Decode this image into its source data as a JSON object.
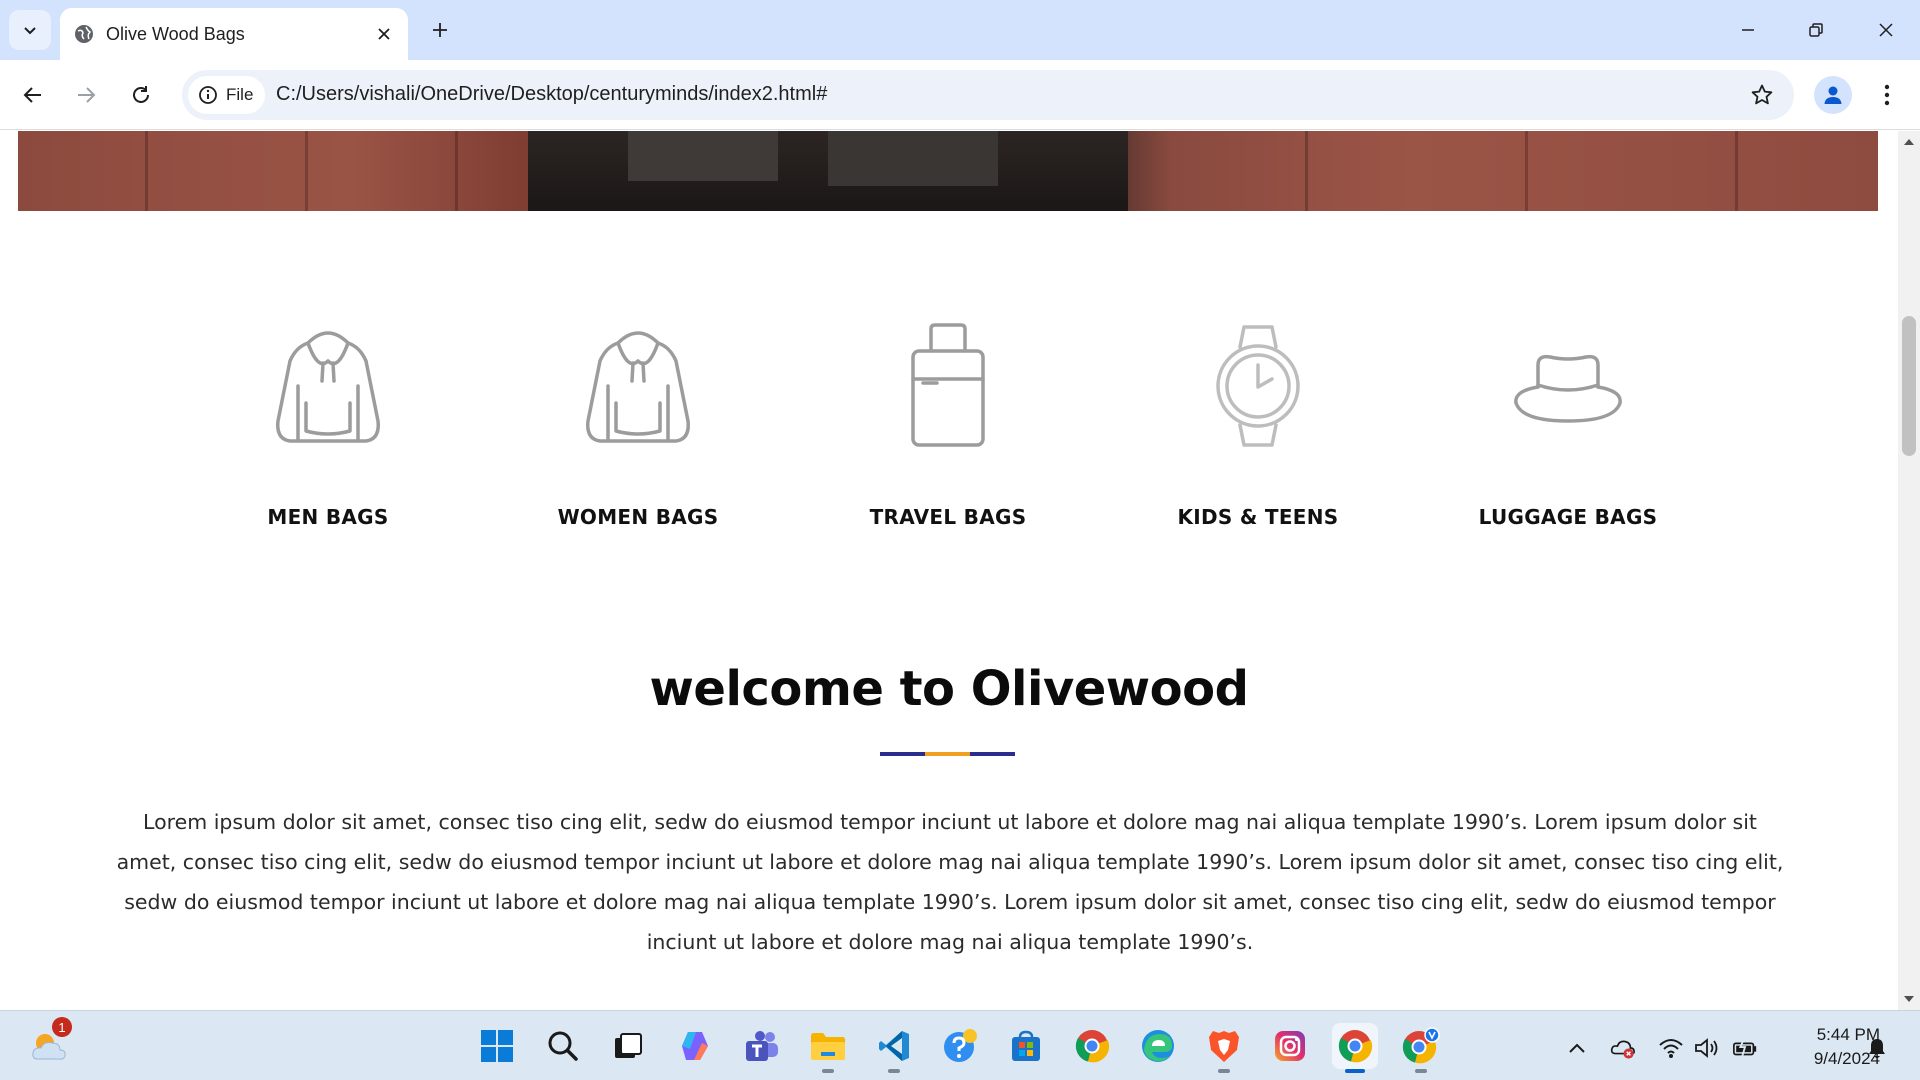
{
  "browser": {
    "tab_title": "Olive Wood Bags",
    "site_chip_label": "File",
    "url": "C:/Users/vishali/OneDrive/Desktop/centuryminds/index2.html#"
  },
  "page": {
    "categories": [
      {
        "label": "MEN BAGS",
        "icon": "hoodie-icon"
      },
      {
        "label": "WOMEN BAGS",
        "icon": "hoodie-icon"
      },
      {
        "label": "TRAVEL BAGS",
        "icon": "suitcase-icon"
      },
      {
        "label": "KIDS & TEENS",
        "icon": "watch-icon"
      },
      {
        "label": "LUGGAGE BAGS",
        "icon": "hat-icon"
      }
    ],
    "welcome_heading": "welcome to Olivewood",
    "divider_colors": [
      "#2b2d8e",
      "#f0a020",
      "#2b2d8e"
    ],
    "intro_text": "Lorem ipsum dolor sit amet, consec tiso cing elit, sedw do eiusmod tempor inciunt ut labore et dolore mag nai aliqua template 1990’s. Lorem ipsum dolor sit amet, consec tiso cing elit, sedw do eiusmod tempor inciunt ut labore et dolore mag nai aliqua template 1990’s. Lorem ipsum dolor sit amet, consec tiso cing elit, sedw do eiusmod tempor inciunt ut labore et dolore mag nai aliqua template 1990’s. Lorem ipsum dolor sit amet, consec tiso cing elit, sedw do eiusmod tempor inciunt ut labore et dolore mag nai aliqua template 1990’s."
  },
  "taskbar": {
    "weather_badge": "1",
    "apps": [
      "start-icon",
      "search-icon",
      "task-view-icon",
      "copilot-icon",
      "teams-icon",
      "file-explorer-icon",
      "vscode-icon",
      "help-icon",
      "store-icon",
      "chrome-icon",
      "edge-icon",
      "brave-icon",
      "instagram-icon",
      "chrome-active-icon",
      "chrome-profile-icon"
    ],
    "time": "5:44 PM",
    "date": "9/4/2024"
  },
  "colors": {
    "tab_strip": "#d3e3fd",
    "icon_gray": "#9c9c9c",
    "accent_blue": "#2b2d8e",
    "accent_orange": "#f0a020"
  }
}
